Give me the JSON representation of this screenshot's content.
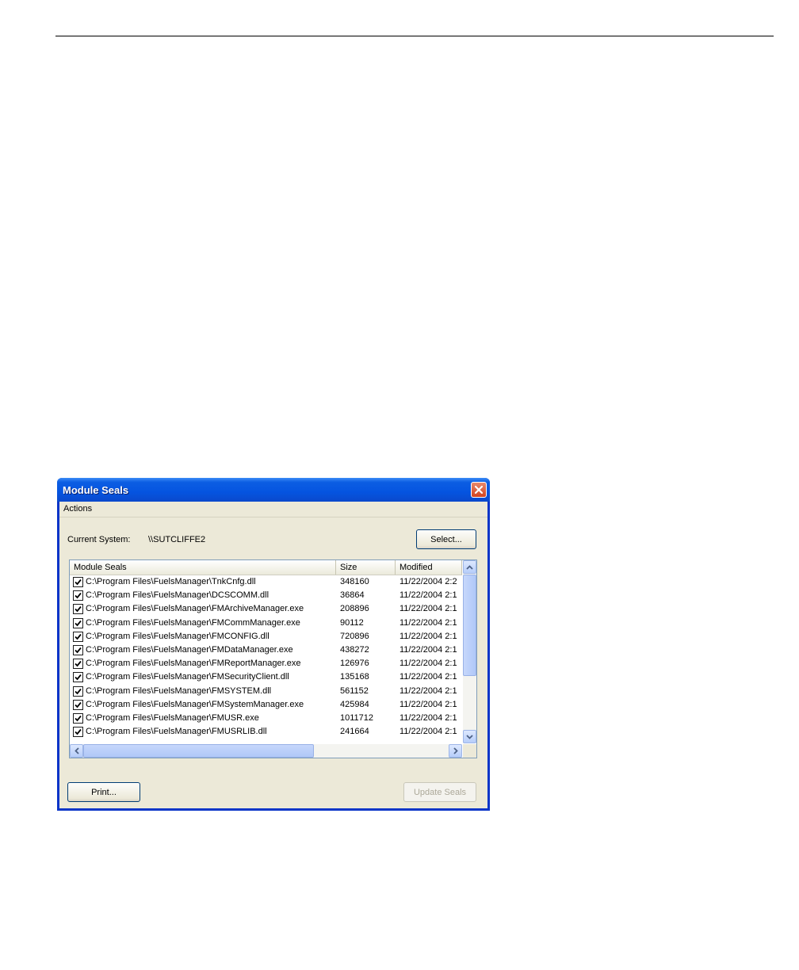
{
  "window": {
    "title": "Module Seals",
    "menu": [
      "Actions"
    ]
  },
  "system": {
    "label": "Current System:",
    "value": "\\\\SUTCLIFFE2",
    "select_label": "Select..."
  },
  "list": {
    "columns": [
      "Module Seals",
      "Size",
      "Modified"
    ],
    "rows": [
      {
        "checked": true,
        "path": "C:\\Program Files\\FuelsManager\\TnkCnfg.dll",
        "size": "348160",
        "modified": "11/22/2004  2:2"
      },
      {
        "checked": true,
        "path": "C:\\Program Files\\FuelsManager\\DCSCOMM.dll",
        "size": "36864",
        "modified": "11/22/2004  2:1"
      },
      {
        "checked": true,
        "path": "C:\\Program Files\\FuelsManager\\FMArchiveManager.exe",
        "size": "208896",
        "modified": "11/22/2004  2:1"
      },
      {
        "checked": true,
        "path": "C:\\Program Files\\FuelsManager\\FMCommManager.exe",
        "size": "90112",
        "modified": "11/22/2004  2:1"
      },
      {
        "checked": true,
        "path": "C:\\Program Files\\FuelsManager\\FMCONFIG.dll",
        "size": "720896",
        "modified": "11/22/2004  2:1"
      },
      {
        "checked": true,
        "path": "C:\\Program Files\\FuelsManager\\FMDataManager.exe",
        "size": "438272",
        "modified": "11/22/2004  2:1"
      },
      {
        "checked": true,
        "path": "C:\\Program Files\\FuelsManager\\FMReportManager.exe",
        "size": "126976",
        "modified": "11/22/2004  2:1"
      },
      {
        "checked": true,
        "path": "C:\\Program Files\\FuelsManager\\FMSecurityClient.dll",
        "size": "135168",
        "modified": "11/22/2004  2:1"
      },
      {
        "checked": true,
        "path": "C:\\Program Files\\FuelsManager\\FMSYSTEM.dll",
        "size": "561152",
        "modified": "11/22/2004  2:1"
      },
      {
        "checked": true,
        "path": "C:\\Program Files\\FuelsManager\\FMSystemManager.exe",
        "size": "425984",
        "modified": "11/22/2004  2:1"
      },
      {
        "checked": true,
        "path": "C:\\Program Files\\FuelsManager\\FMUSR.exe",
        "size": "1011712",
        "modified": "11/22/2004  2:1"
      },
      {
        "checked": true,
        "path": "C:\\Program Files\\FuelsManager\\FMUSRLIB.dll",
        "size": "241664",
        "modified": "11/22/2004  2:1"
      }
    ]
  },
  "buttons": {
    "print": "Print...",
    "update_seals": "Update Seals"
  },
  "icons": {
    "close": "close-icon",
    "check": "check-icon",
    "scroll_up": "chevron-up-icon",
    "scroll_down": "chevron-down-icon",
    "scroll_left": "chevron-left-icon",
    "scroll_right": "chevron-right-icon"
  },
  "colors": {
    "titlebar": "#0554e0",
    "close_button": "#d3431f",
    "dialog_face": "#ece9d8",
    "list_border": "#7f9db9"
  }
}
